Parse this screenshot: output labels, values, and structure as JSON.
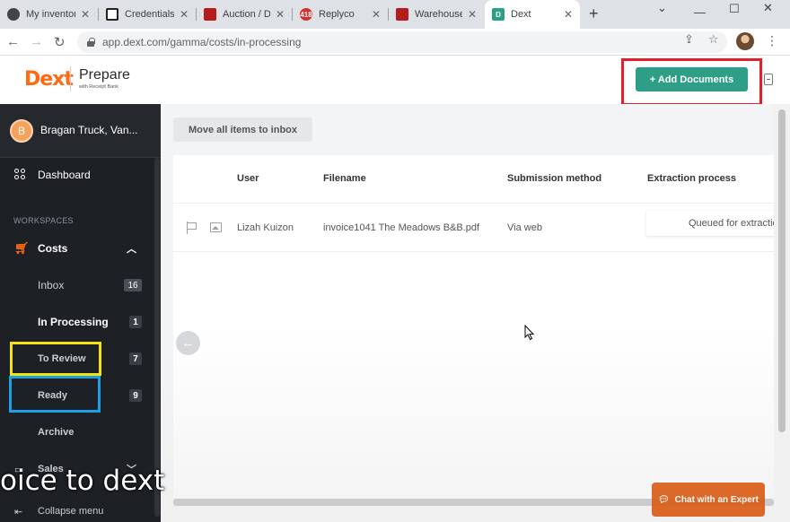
{
  "browser": {
    "tabs": [
      {
        "label": "My inventory",
        "color": "#444"
      },
      {
        "label": "Credentials",
        "color": "#222"
      },
      {
        "label": "Auction / D",
        "color": "#b71c1c"
      },
      {
        "label": "Replyco",
        "color": "#d32f2f",
        "badge": "418"
      },
      {
        "label": "Warehouse",
        "color": "#b71c1c"
      },
      {
        "label": "Dext",
        "color": "#2e9e86",
        "active": true
      }
    ],
    "url": "app.dext.com/gamma/costs/in-processing"
  },
  "header": {
    "logo": "Dext",
    "product": "Prepare",
    "product_sub": "with Receipt Bank",
    "add_documents_label": "+ Add Documents"
  },
  "sidebar": {
    "account_initial": "B",
    "account_name": "Bragan Truck, Van...",
    "dashboard_label": "Dashboard",
    "section_label": "WORKSPACES",
    "costs_label": "Costs",
    "items": [
      {
        "label": "Inbox",
        "count": "16"
      },
      {
        "label": "In Processing",
        "count": "1"
      },
      {
        "label": "To Review",
        "count": "7"
      },
      {
        "label": "Ready",
        "count": "9"
      },
      {
        "label": "Archive",
        "count": ""
      }
    ],
    "sales_label": "Sales",
    "collapse_label": "Collapse menu"
  },
  "main": {
    "move_button_label": "Move all items to inbox",
    "columns": [
      "User",
      "Filename",
      "Submission method",
      "Extraction process"
    ],
    "rows": [
      {
        "user": "Lizah Kuizon",
        "filename": "invoice1041 The Meadows B&B.pdf",
        "method": "Via web",
        "extraction": "Queued for extraction"
      }
    ]
  },
  "chat_label": "Chat with an Expert",
  "caption": "oice to dext",
  "colors": {
    "brand": "#ff6a13",
    "accent": "#2e9e86",
    "sidebar": "#1d2126"
  }
}
